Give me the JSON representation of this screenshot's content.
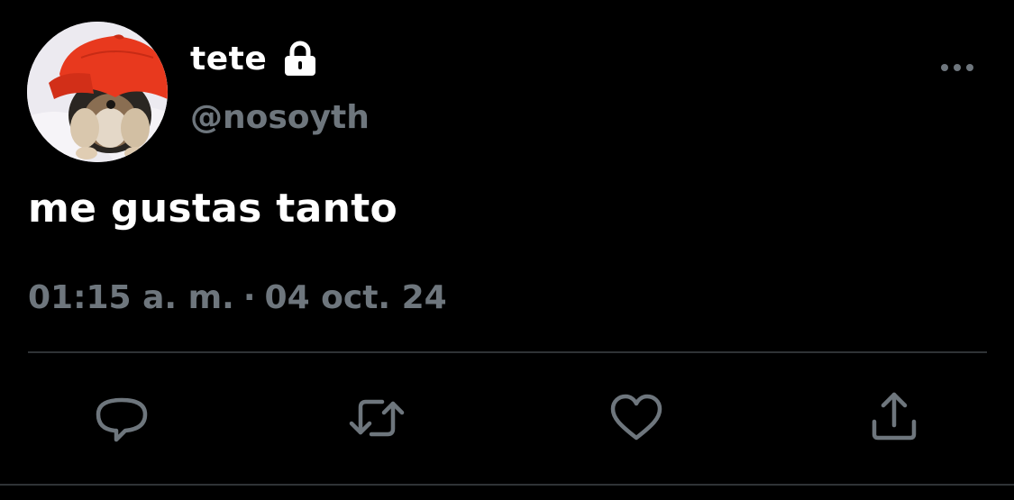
{
  "user": {
    "display_name": "tete",
    "handle": "@nosoyth",
    "protected_icon": "lock-icon",
    "avatar_icon": "avatar-dog-red-cap"
  },
  "tweet": {
    "text": "me gustas tanto",
    "time": "01:15 a. m.",
    "separator": "·",
    "date": "04 oct. 24"
  },
  "actions": {
    "more_icon": "more-icon",
    "reply_icon": "reply-icon",
    "retweet_icon": "retweet-icon",
    "like_icon": "like-icon",
    "share_icon": "share-icon"
  },
  "colors": {
    "background": "#000000",
    "primary_text": "#ffffff",
    "secondary_text": "#6e767d",
    "divider": "#2f3336",
    "avatar_cap": "#e8391e"
  }
}
